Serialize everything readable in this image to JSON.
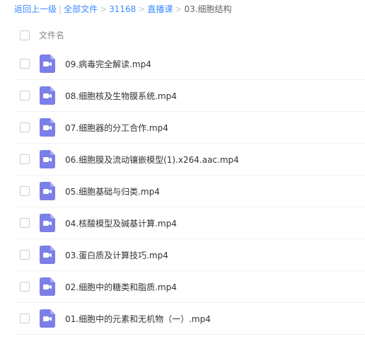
{
  "breadcrumb": {
    "back": "返回上一级",
    "all_files": "全部文件",
    "level1": "31168",
    "level2": "直播课",
    "current": "03.细胞结构"
  },
  "list": {
    "header_label": "文件名",
    "files": [
      {
        "name": "09.病毒完全解读.mp4",
        "icon": "video-file-icon"
      },
      {
        "name": "08.细胞核及生物膜系统.mp4",
        "icon": "video-file-icon"
      },
      {
        "name": "07.细胞器的分工合作.mp4",
        "icon": "video-file-icon"
      },
      {
        "name": "06.细胞膜及流动镶嵌模型(1).x264.aac.mp4",
        "icon": "video-file-icon"
      },
      {
        "name": "05.细胞基础与归类.mp4",
        "icon": "video-file-icon"
      },
      {
        "name": "04.核酸模型及碱基计算.mp4",
        "icon": "video-file-icon"
      },
      {
        "name": "03.蛋白质及计算技巧.mp4",
        "icon": "video-file-icon"
      },
      {
        "name": "02.细胞中的糖类和脂质.mp4",
        "icon": "video-file-icon"
      },
      {
        "name": "01.细胞中的元素和无机物（一）.mp4",
        "icon": "video-file-icon"
      }
    ]
  },
  "colors": {
    "link": "#3b8cff",
    "video_icon": "#7b7fe8"
  }
}
